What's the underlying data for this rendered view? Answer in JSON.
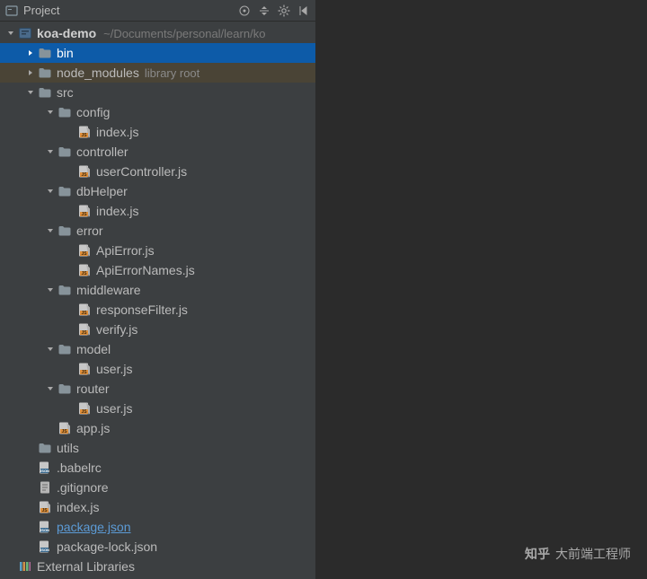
{
  "panel": {
    "title": "Project",
    "toolbar": [
      "target-icon",
      "collapse-icon",
      "settings-icon",
      "hide-icon"
    ]
  },
  "root": {
    "name": "koa-demo",
    "path": "~/Documents/personal/learn/ko"
  },
  "tree": [
    {
      "depth": 0,
      "arrow": "down",
      "icon": "module",
      "labelKey": "root.name",
      "bold": true,
      "pathKey": "root.path"
    },
    {
      "depth": 1,
      "arrow": "right",
      "icon": "folder",
      "label": "bin",
      "selected": true
    },
    {
      "depth": 1,
      "arrow": "right",
      "icon": "folder",
      "label": "node_modules",
      "muted": "library root",
      "lib": true
    },
    {
      "depth": 1,
      "arrow": "down",
      "icon": "folder",
      "label": "src"
    },
    {
      "depth": 2,
      "arrow": "down",
      "icon": "folder",
      "label": "config"
    },
    {
      "depth": 3,
      "arrow": "none",
      "icon": "js",
      "label": "index.js"
    },
    {
      "depth": 2,
      "arrow": "down",
      "icon": "folder",
      "label": "controller"
    },
    {
      "depth": 3,
      "arrow": "none",
      "icon": "js",
      "label": "userController.js"
    },
    {
      "depth": 2,
      "arrow": "down",
      "icon": "folder",
      "label": "dbHelper"
    },
    {
      "depth": 3,
      "arrow": "none",
      "icon": "js",
      "label": "index.js"
    },
    {
      "depth": 2,
      "arrow": "down",
      "icon": "folder",
      "label": "error"
    },
    {
      "depth": 3,
      "arrow": "none",
      "icon": "js",
      "label": "ApiError.js"
    },
    {
      "depth": 3,
      "arrow": "none",
      "icon": "js",
      "label": "ApiErrorNames.js"
    },
    {
      "depth": 2,
      "arrow": "down",
      "icon": "folder",
      "label": "middleware"
    },
    {
      "depth": 3,
      "arrow": "none",
      "icon": "js",
      "label": "responseFilter.js"
    },
    {
      "depth": 3,
      "arrow": "none",
      "icon": "js",
      "label": "verify.js"
    },
    {
      "depth": 2,
      "arrow": "down",
      "icon": "folder",
      "label": "model"
    },
    {
      "depth": 3,
      "arrow": "none",
      "icon": "js",
      "label": "user.js"
    },
    {
      "depth": 2,
      "arrow": "down",
      "icon": "folder",
      "label": "router"
    },
    {
      "depth": 3,
      "arrow": "none",
      "icon": "js",
      "label": "user.js"
    },
    {
      "depth": 2,
      "arrow": "none",
      "icon": "js",
      "label": "app.js"
    },
    {
      "depth": 1,
      "arrow": "none",
      "icon": "folder",
      "label": "utils"
    },
    {
      "depth": 1,
      "arrow": "none",
      "icon": "json",
      "label": ".babelrc"
    },
    {
      "depth": 1,
      "arrow": "none",
      "icon": "file",
      "label": ".gitignore"
    },
    {
      "depth": 1,
      "arrow": "none",
      "icon": "js",
      "label": "index.js"
    },
    {
      "depth": 1,
      "arrow": "none",
      "icon": "json",
      "label": "package.json",
      "link": true
    },
    {
      "depth": 1,
      "arrow": "none",
      "icon": "json",
      "label": "package-lock.json"
    },
    {
      "depth": 0,
      "arrow": "none",
      "icon": "libs",
      "label": "External Libraries"
    }
  ],
  "watermark": {
    "brand": "知乎",
    "text": "大前端工程师"
  }
}
